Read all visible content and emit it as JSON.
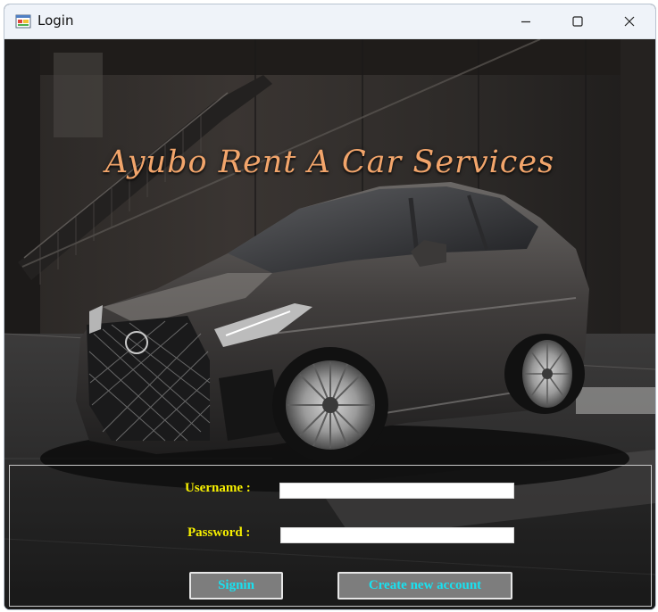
{
  "window": {
    "title": "Login",
    "app_icon": "windows-form-icon",
    "controls": {
      "minimize": "minimize-icon",
      "maximize": "maximize-icon",
      "close": "close-icon"
    }
  },
  "banner": {
    "title": "Ayubo Rent A Car Services",
    "title_color": "#f2a56b",
    "background_image": "dark-grey-sedan-parked-in-garage"
  },
  "login_form": {
    "username_label": "Username :",
    "username_value": "",
    "password_label": "Password :",
    "password_value": "",
    "label_color": "#f7f000"
  },
  "buttons": {
    "signin_label": "Signin",
    "create_account_label": "Create new account",
    "text_color": "#19e1f0",
    "background_color": "#7d7d7d"
  }
}
